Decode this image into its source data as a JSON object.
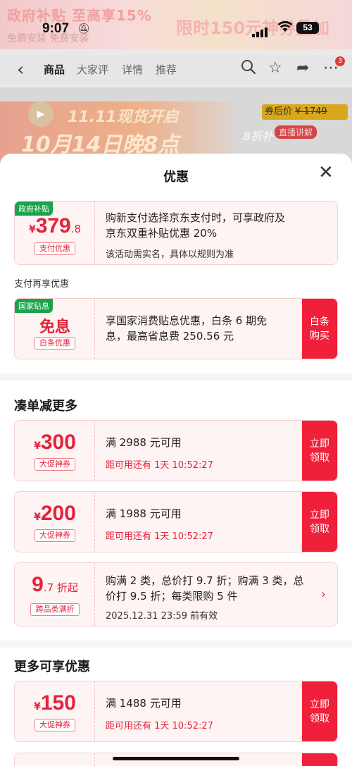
{
  "status": {
    "time": "9:07",
    "battery": "53",
    "bell_icon": "bell-off-icon"
  },
  "bg_page": {
    "banner_text_1": "政府补贴 至高享15%",
    "banner_text_2": "免费安装  免费安装",
    "banner_text_3": "限时150元神券叠加",
    "nav_tabs": [
      "商品",
      "大家评",
      "详情",
      "推荐"
    ],
    "cart_badge": "3",
    "hero_line1": "11.11现货开启",
    "hero_line2": "10月14日晚8点",
    "hero_price_label": "券后价",
    "hero_price_old": "¥ 1749",
    "hero_live": "直播讲解",
    "hero_discount": "8折补"
  },
  "sheet": {
    "title": "优惠",
    "gov": {
      "tag": "政府补贴",
      "yen": "¥",
      "amount": "379",
      "decimal": ".8",
      "chip": "支付优惠",
      "desc_line1": "购新支付选择京东支付时，可享政府及",
      "desc_line2": "京东双重补贴优惠 20%",
      "note": "该活动需实名，具体以规则为准"
    },
    "pay_again_label": "支付再享优惠",
    "interest": {
      "tag": "国家贴息",
      "word": "免息",
      "chip": "白条优惠",
      "desc_line1": "享国家消费贴息优惠，白条 6 期免",
      "desc_line2": "息，最高省息费 250.56 元",
      "cta_line1": "白条",
      "cta_line2": "购买"
    },
    "section_more_discount": "凑单减更多",
    "coupons": [
      {
        "yen": "¥",
        "amount": "300",
        "chip": "大促神券",
        "title": "满 2988 元可用",
        "countdown": "距可用还有 1天 10:52:27",
        "cta_line1": "立即",
        "cta_line2": "领取"
      },
      {
        "yen": "¥",
        "amount": "200",
        "chip": "大促神券",
        "title": "满 1988 元可用",
        "countdown": "距可用还有 1天 10:52:27",
        "cta_line1": "立即",
        "cta_line2": "领取"
      }
    ],
    "cross_category": {
      "big": "9",
      "small": ".7 折起",
      "chip": "跨品类满折",
      "desc_line1": "购满 2 类，总价打 9.7 折；购满 3 类，总",
      "desc_line2": "价打 9.5 折；每类限购 5 件",
      "expiry": "2025.12.31 23:59 前有效",
      "arrow": "›"
    },
    "section_more_available": "更多可享优惠",
    "coupon_150": {
      "yen": "¥",
      "amount": "150",
      "chip": "大促神券",
      "title": "满 1488 元可用",
      "countdown": "距可用还有 1天 10:52:27",
      "cta_line1": "立即",
      "cta_line2": "领取"
    }
  },
  "colors": {
    "accent_red": "#f0203a",
    "price_red": "#e4223a",
    "tag_green": "#1aa34a",
    "card_bg": "#fff4f4"
  }
}
